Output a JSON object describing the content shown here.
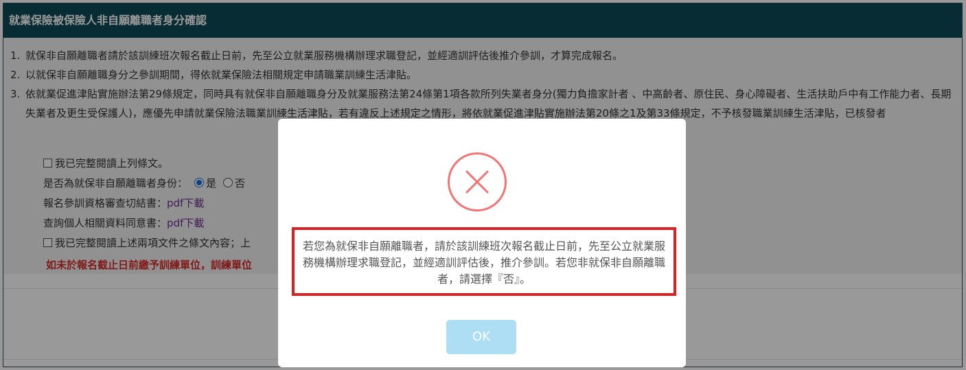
{
  "panel": {
    "title": "就業保險被保險人非自願離職者身分確認",
    "terms": [
      {
        "num": "1.",
        "text": "就保非自願離職者請於該訓練班次報名截止日前，先至公立就業服務機構辦理求職登記，並經適訓評估後推介參訓，才算完成報名。"
      },
      {
        "num": "2.",
        "text": "以就保非自願離職身分之參訓期間，得依就業保險法相關規定申請職業訓練生活津貼。"
      },
      {
        "num": "3.",
        "text": "依就業促進津貼實施辦法第29條規定，同時具有就保非自願離職身分及就業服務法第24條第1項各款所列失業者身分(獨力負擔家計者 、中高齡者、原住民、身心障礙者、生活扶助戶中有工作能力者、長期失業者及更生受保護人)，應優先申請就業保險法職業訓練生活津貼，若有違反上述規定之情形，將依就業促進津貼實施辦法第20條之1及第33條規定，不予核發職業訓練生活津貼，已核發者"
      }
    ],
    "read_checkbox_label": "我已完整閱讀上列條文。",
    "identity_question": "是否為就保非自願離職者身份：",
    "identity_options": [
      "是",
      "否"
    ],
    "identity_selected": "是",
    "affidavit_label": "報名參訓資格審查切結書：",
    "affidavit_link": "pdf下載",
    "consent_label": "查詢個人相關資料同意書：",
    "consent_link": "pdf下載",
    "docs_checkbox_label": "我已完整閱讀上述兩項文件之條文內容；上",
    "warning": "如未於報名截止日前繳予訓練單位，訓練單位"
  },
  "modal": {
    "icon": "error-x-icon",
    "message": "若您為就保非自願離職者，請於該訓練班次報名截止日前，先至公立就業服務機構辦理求職登記，並經適訓評估後，推介參訓。若您非就保非自願離職者，請選擇『否』。",
    "ok_label": "OK"
  },
  "colors": {
    "header_bg": "#0e4a57",
    "icon_red": "#f27474",
    "highlight_border": "#e02020",
    "ok_button": "#aedef4",
    "warning_text": "#d92a2a",
    "link_text": "#6b2f91"
  }
}
